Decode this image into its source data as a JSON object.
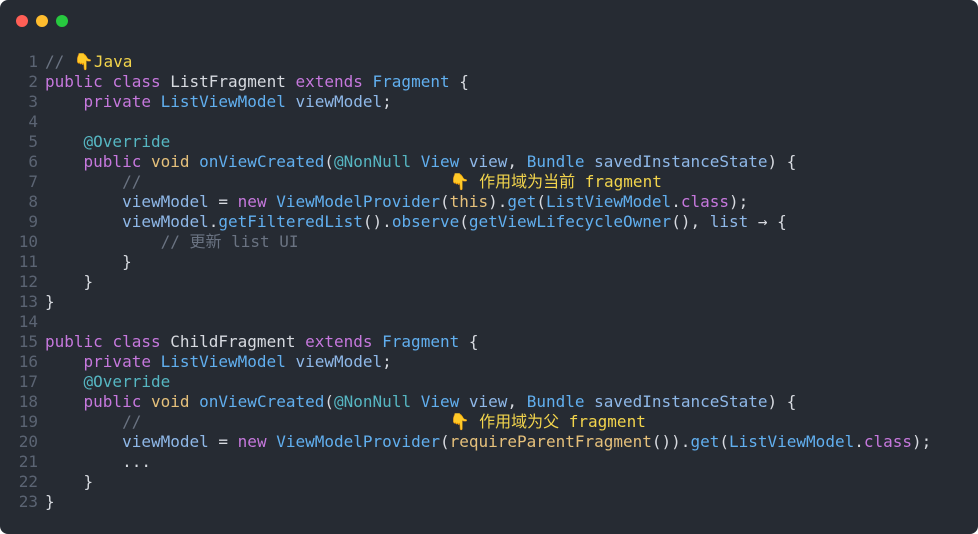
{
  "window": {
    "controls": [
      "close",
      "minimize",
      "maximize"
    ]
  },
  "code": {
    "lines": [
      {
        "n": "1",
        "tokens": [
          {
            "t": "// ",
            "c": "cm"
          },
          {
            "t": "👇",
            "c": "emoji"
          },
          {
            "t": "Java",
            "c": "ys"
          }
        ]
      },
      {
        "n": "2",
        "tokens": [
          {
            "t": "public ",
            "c": "kw"
          },
          {
            "t": "class ",
            "c": "kw"
          },
          {
            "t": "ListFragment ",
            "c": "pl"
          },
          {
            "t": "extends ",
            "c": "kw"
          },
          {
            "t": "Fragment",
            "c": "ty"
          },
          {
            "t": " {",
            "c": "pl"
          }
        ]
      },
      {
        "n": "3",
        "tokens": [
          {
            "t": "    ",
            "c": "pl"
          },
          {
            "t": "private ",
            "c": "kw"
          },
          {
            "t": "ListViewModel ",
            "c": "ty"
          },
          {
            "t": "viewModel",
            "c": "var"
          },
          {
            "t": ";",
            "c": "pl"
          }
        ]
      },
      {
        "n": "4",
        "tokens": []
      },
      {
        "n": "5",
        "tokens": [
          {
            "t": "    ",
            "c": "pl"
          },
          {
            "t": "@Override",
            "c": "an"
          }
        ]
      },
      {
        "n": "6",
        "tokens": [
          {
            "t": "    ",
            "c": "pl"
          },
          {
            "t": "public ",
            "c": "kw"
          },
          {
            "t": "void ",
            "c": "pa"
          },
          {
            "t": "onViewCreated",
            "c": "fn"
          },
          {
            "t": "(",
            "c": "pl"
          },
          {
            "t": "@NonNull ",
            "c": "an"
          },
          {
            "t": "View ",
            "c": "ty"
          },
          {
            "t": "view",
            "c": "var"
          },
          {
            "t": ", ",
            "c": "pl"
          },
          {
            "t": "Bundle ",
            "c": "ty"
          },
          {
            "t": "savedInstanceState",
            "c": "var"
          },
          {
            "t": ") {",
            "c": "pl"
          }
        ]
      },
      {
        "n": "7",
        "tokens": [
          {
            "t": "        ",
            "c": "pl"
          },
          {
            "t": "//                                ",
            "c": "cm"
          },
          {
            "t": "👇",
            "c": "emoji"
          },
          {
            "t": " 作用域为当前 fragment",
            "c": "ys"
          }
        ]
      },
      {
        "n": "8",
        "tokens": [
          {
            "t": "        ",
            "c": "pl"
          },
          {
            "t": "viewModel",
            "c": "var"
          },
          {
            "t": " = ",
            "c": "pl"
          },
          {
            "t": "new ",
            "c": "kw"
          },
          {
            "t": "ViewModelProvider",
            "c": "fn"
          },
          {
            "t": "(",
            "c": "pl"
          },
          {
            "t": "this",
            "c": "pa"
          },
          {
            "t": ").",
            "c": "pl"
          },
          {
            "t": "get",
            "c": "fn"
          },
          {
            "t": "(",
            "c": "pl"
          },
          {
            "t": "ListViewModel",
            "c": "ty"
          },
          {
            "t": ".",
            "c": "pl"
          },
          {
            "t": "class",
            "c": "kw"
          },
          {
            "t": ");",
            "c": "pl"
          }
        ]
      },
      {
        "n": "9",
        "tokens": [
          {
            "t": "        ",
            "c": "pl"
          },
          {
            "t": "viewModel",
            "c": "var"
          },
          {
            "t": ".",
            "c": "pl"
          },
          {
            "t": "getFilteredList",
            "c": "fn"
          },
          {
            "t": "().",
            "c": "pl"
          },
          {
            "t": "observe",
            "c": "fn"
          },
          {
            "t": "(",
            "c": "pl"
          },
          {
            "t": "getViewLifecycleOwner",
            "c": "fn"
          },
          {
            "t": "(), ",
            "c": "pl"
          },
          {
            "t": "list",
            "c": "var"
          },
          {
            "t": " → {",
            "c": "op"
          }
        ]
      },
      {
        "n": "10",
        "tokens": [
          {
            "t": "            ",
            "c": "pl"
          },
          {
            "t": "// 更新 list UI",
            "c": "cm"
          }
        ]
      },
      {
        "n": "11",
        "tokens": [
          {
            "t": "        ",
            "c": "pl"
          },
          {
            "t": "}",
            "c": "pl"
          }
        ]
      },
      {
        "n": "12",
        "tokens": [
          {
            "t": "    ",
            "c": "pl"
          },
          {
            "t": "}",
            "c": "pl"
          }
        ]
      },
      {
        "n": "13",
        "tokens": [
          {
            "t": "}",
            "c": "pl"
          }
        ]
      },
      {
        "n": "14",
        "tokens": []
      },
      {
        "n": "15",
        "tokens": [
          {
            "t": "public ",
            "c": "kw"
          },
          {
            "t": "class ",
            "c": "kw"
          },
          {
            "t": "ChildFragment ",
            "c": "pl"
          },
          {
            "t": "extends ",
            "c": "kw"
          },
          {
            "t": "Fragment",
            "c": "ty"
          },
          {
            "t": " {",
            "c": "pl"
          }
        ]
      },
      {
        "n": "16",
        "tokens": [
          {
            "t": "    ",
            "c": "pl"
          },
          {
            "t": "private ",
            "c": "kw"
          },
          {
            "t": "ListViewModel ",
            "c": "ty"
          },
          {
            "t": "viewModel",
            "c": "var"
          },
          {
            "t": ";",
            "c": "pl"
          }
        ]
      },
      {
        "n": "17",
        "tokens": [
          {
            "t": "    ",
            "c": "pl"
          },
          {
            "t": "@Override",
            "c": "an"
          }
        ]
      },
      {
        "n": "18",
        "tokens": [
          {
            "t": "    ",
            "c": "pl"
          },
          {
            "t": "public ",
            "c": "kw"
          },
          {
            "t": "void ",
            "c": "pa"
          },
          {
            "t": "onViewCreated",
            "c": "fn"
          },
          {
            "t": "(",
            "c": "pl"
          },
          {
            "t": "@NonNull ",
            "c": "an"
          },
          {
            "t": "View ",
            "c": "ty"
          },
          {
            "t": "view",
            "c": "var"
          },
          {
            "t": ", ",
            "c": "pl"
          },
          {
            "t": "Bundle ",
            "c": "ty"
          },
          {
            "t": "savedInstanceState",
            "c": "var"
          },
          {
            "t": ") {",
            "c": "pl"
          }
        ]
      },
      {
        "n": "19",
        "tokens": [
          {
            "t": "        ",
            "c": "pl"
          },
          {
            "t": "//                                ",
            "c": "cm"
          },
          {
            "t": "👇",
            "c": "emoji"
          },
          {
            "t": " 作用域为父 fragment",
            "c": "ys"
          }
        ]
      },
      {
        "n": "20",
        "tokens": [
          {
            "t": "        ",
            "c": "pl"
          },
          {
            "t": "viewModel",
            "c": "var"
          },
          {
            "t": " = ",
            "c": "pl"
          },
          {
            "t": "new ",
            "c": "kw"
          },
          {
            "t": "ViewModelProvider",
            "c": "fn"
          },
          {
            "t": "(",
            "c": "pl"
          },
          {
            "t": "requireParentFragment",
            "c": "pa"
          },
          {
            "t": "()).",
            "c": "pl"
          },
          {
            "t": "get",
            "c": "fn"
          },
          {
            "t": "(",
            "c": "pl"
          },
          {
            "t": "ListViewModel",
            "c": "ty"
          },
          {
            "t": ".",
            "c": "pl"
          },
          {
            "t": "class",
            "c": "kw"
          },
          {
            "t": ");",
            "c": "pl"
          }
        ]
      },
      {
        "n": "21",
        "tokens": [
          {
            "t": "        ",
            "c": "pl"
          },
          {
            "t": "...",
            "c": "pl"
          }
        ]
      },
      {
        "n": "22",
        "tokens": [
          {
            "t": "    ",
            "c": "pl"
          },
          {
            "t": "}",
            "c": "pl"
          }
        ]
      },
      {
        "n": "23",
        "tokens": [
          {
            "t": "}",
            "c": "pl"
          }
        ]
      }
    ]
  }
}
